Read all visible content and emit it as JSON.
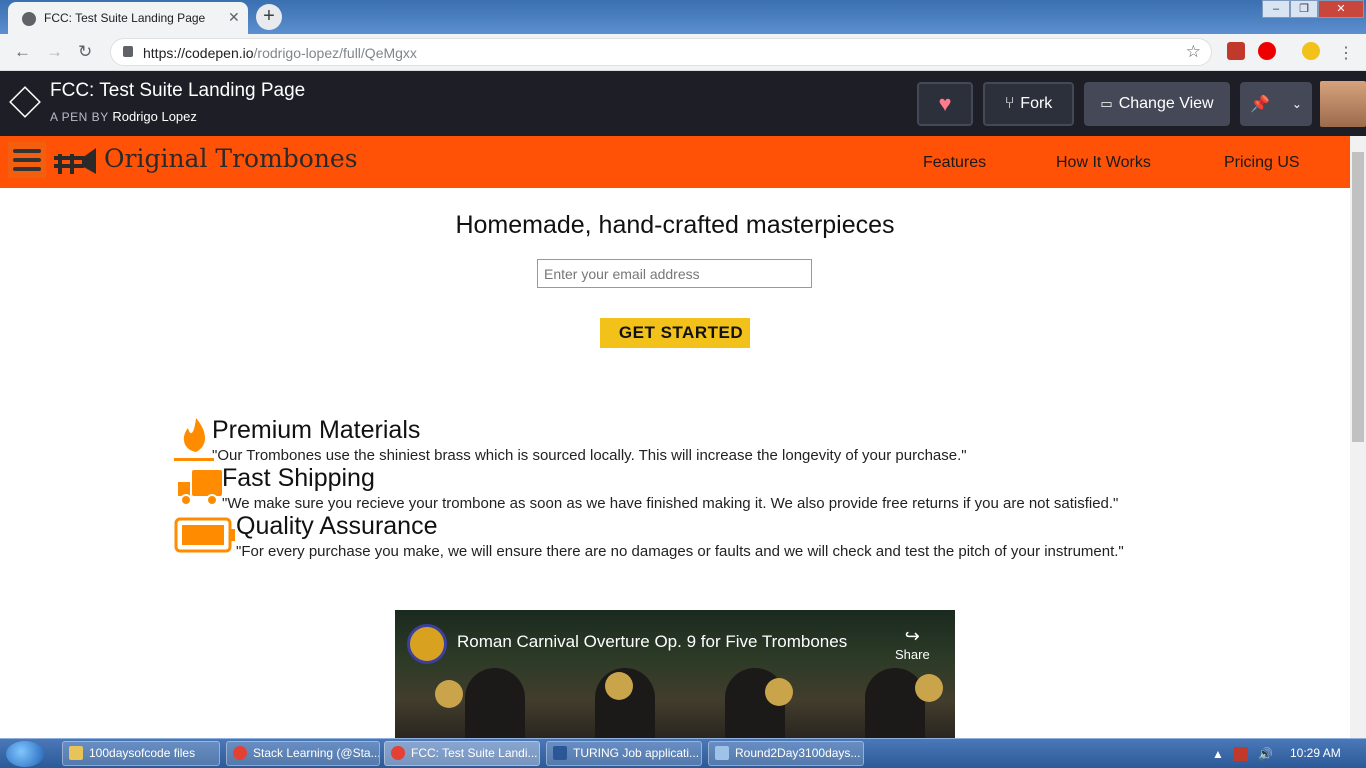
{
  "browser": {
    "tab_title": "FCC: Test Suite Landing Page",
    "tab_close": "✕",
    "new_tab": "+",
    "url_host": "https://codepen.io",
    "url_path": "/rodrigo-lopez/full/QeMgxx",
    "window_controls": {
      "minimize": "–",
      "maximize": "❐",
      "close": "✕"
    }
  },
  "codepen": {
    "title": "FCC: Test Suite Landing Page",
    "byline": "A PEN BY",
    "author": "Rodrigo Lopez",
    "fork_label": "Fork",
    "change_view_label": "Change View"
  },
  "site": {
    "brand": "Original Trombones",
    "nav": [
      "Features",
      "How It Works",
      "Pricing US"
    ],
    "hero_title": "Homemade, hand-crafted masterpieces",
    "email_placeholder": "Enter your email address",
    "cta_label": "GET STARTED",
    "features": [
      {
        "title": "Premium Materials",
        "desc": "\"Our Trombones use the shiniest brass which is sourced locally. This will increase the longevity of your purchase.\"",
        "icon": "fire-icon"
      },
      {
        "title": "Fast Shipping",
        "desc": "\"We make sure you recieve your trombone as soon as we have finished making it. We also provide free returns if you are not satisfied.\"",
        "icon": "truck-icon"
      },
      {
        "title": "Quality Assurance",
        "desc": "\"For every purchase you make, we will ensure there are no damages or faults and we will check and test the pitch of your instrument.\"",
        "icon": "battery-icon"
      }
    ],
    "video": {
      "title": "Roman Carnival Overture Op. 9 for Five Trombones",
      "share_label": "Share"
    }
  },
  "taskbar": {
    "items": [
      {
        "label": "100daysofcode files",
        "color": "#e8c35a"
      },
      {
        "label": "Stack Learning (@Sta...",
        "color": "#e44134"
      },
      {
        "label": "FCC: Test Suite Landi...",
        "color": "#e44134"
      },
      {
        "label": "TURING Job applicati...",
        "color": "#2b5797"
      },
      {
        "label": "Round2Day3100days...",
        "color": "#9fc3e8"
      }
    ],
    "clock": "10:29 AM"
  },
  "colors": {
    "accent": "#ff5206",
    "cta": "#f2c21b",
    "icon_orange": "#ff8c00",
    "codepen_bg": "#1e1f26"
  }
}
